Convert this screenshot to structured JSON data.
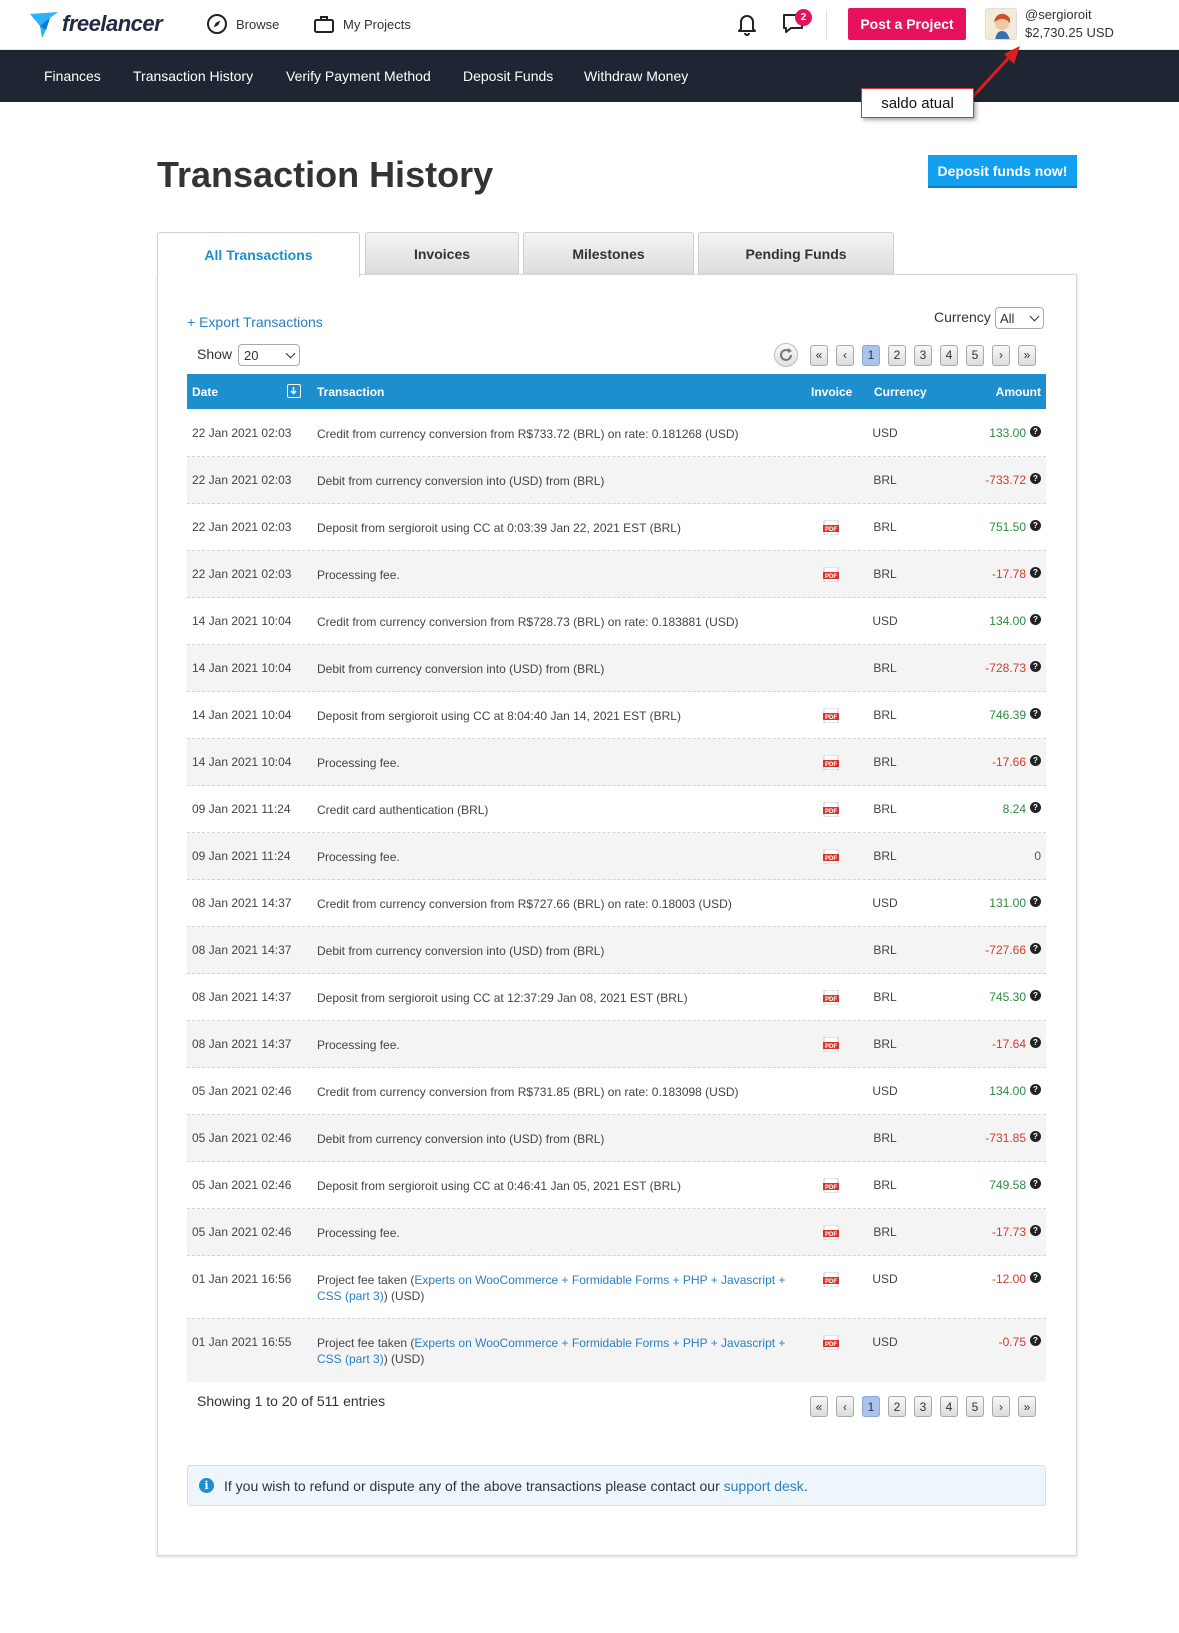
{
  "topbar": {
    "logo_text": "freelancer",
    "browse_label": "Browse",
    "my_projects_label": "My Projects",
    "notification_count": "2",
    "post_project_label": "Post a Project",
    "username": "@sergioroit",
    "balance": "$2,730.25 USD"
  },
  "subnav": [
    "Finances",
    "Transaction History",
    "Verify Payment Method",
    "Deposit Funds",
    "Withdraw Money"
  ],
  "annotation": {
    "text": "saldo atual",
    "color": "#dd1f1f"
  },
  "page": {
    "title": "Transaction History",
    "deposit_button": "Deposit funds now!"
  },
  "tabs": [
    "All Transactions",
    "Invoices",
    "Milestones",
    "Pending Funds"
  ],
  "controls": {
    "export_label": "+ Export Transactions",
    "currency_label": "Currency",
    "currency_value": "All",
    "show_label": "Show",
    "show_value": "20",
    "pages": [
      "«",
      "‹",
      "1",
      "2",
      "3",
      "4",
      "5",
      "›",
      "»"
    ],
    "active_page": "1"
  },
  "table": {
    "headers": {
      "date": "Date",
      "transaction": "Transaction",
      "invoice": "Invoice",
      "currency": "Currency",
      "amount": "Amount"
    },
    "rows": [
      {
        "date": "22 Jan 2021 02:03",
        "desc": "Credit from currency conversion from R$733.72 (BRL) on rate: 0.181268 (USD)",
        "pdf": false,
        "currency": "USD",
        "amount": "133.00",
        "sign": "pos",
        "help": true
      },
      {
        "date": "22 Jan 2021 02:03",
        "desc": "Debit from currency conversion into (USD) from (BRL)",
        "pdf": false,
        "currency": "BRL",
        "amount": "-733.72",
        "sign": "neg",
        "help": true
      },
      {
        "date": "22 Jan 2021 02:03",
        "desc": "Deposit from sergioroit using CC at 0:03:39 Jan 22, 2021 EST (BRL)",
        "pdf": true,
        "currency": "BRL",
        "amount": "751.50",
        "sign": "pos",
        "help": true
      },
      {
        "date": "22 Jan 2021 02:03",
        "desc": "Processing fee.",
        "pdf": true,
        "currency": "BRL",
        "amount": "-17.78",
        "sign": "neg",
        "help": true
      },
      {
        "date": "14 Jan 2021 10:04",
        "desc": "Credit from currency conversion from R$728.73 (BRL) on rate: 0.183881 (USD)",
        "pdf": false,
        "currency": "USD",
        "amount": "134.00",
        "sign": "pos",
        "help": true
      },
      {
        "date": "14 Jan 2021 10:04",
        "desc": "Debit from currency conversion into (USD) from (BRL)",
        "pdf": false,
        "currency": "BRL",
        "amount": "-728.73",
        "sign": "neg",
        "help": true
      },
      {
        "date": "14 Jan 2021 10:04",
        "desc": "Deposit from sergioroit using CC at 8:04:40 Jan 14, 2021 EST (BRL)",
        "pdf": true,
        "currency": "BRL",
        "amount": "746.39",
        "sign": "pos",
        "help": true
      },
      {
        "date": "14 Jan 2021 10:04",
        "desc": "Processing fee.",
        "pdf": true,
        "currency": "BRL",
        "amount": "-17.66",
        "sign": "neg",
        "help": true
      },
      {
        "date": "09 Jan 2021 11:24",
        "desc": "Credit card authentication (BRL)",
        "pdf": true,
        "currency": "BRL",
        "amount": "8.24",
        "sign": "pos",
        "help": true
      },
      {
        "date": "09 Jan 2021 11:24",
        "desc": "Processing fee.",
        "pdf": true,
        "currency": "BRL",
        "amount": "0",
        "sign": "zero",
        "help": false
      },
      {
        "date": "08 Jan 2021 14:37",
        "desc": "Credit from currency conversion from R$727.66 (BRL) on rate: 0.18003 (USD)",
        "pdf": false,
        "currency": "USD",
        "amount": "131.00",
        "sign": "pos",
        "help": true
      },
      {
        "date": "08 Jan 2021 14:37",
        "desc": "Debit from currency conversion into (USD) from (BRL)",
        "pdf": false,
        "currency": "BRL",
        "amount": "-727.66",
        "sign": "neg",
        "help": true
      },
      {
        "date": "08 Jan 2021 14:37",
        "desc": "Deposit from sergioroit using CC at 12:37:29 Jan 08, 2021 EST (BRL)",
        "pdf": true,
        "currency": "BRL",
        "amount": "745.30",
        "sign": "pos",
        "help": true
      },
      {
        "date": "08 Jan 2021 14:37",
        "desc": "Processing fee.",
        "pdf": true,
        "currency": "BRL",
        "amount": "-17.64",
        "sign": "neg",
        "help": true
      },
      {
        "date": "05 Jan 2021 02:46",
        "desc": "Credit from currency conversion from R$731.85 (BRL) on rate: 0.183098 (USD)",
        "pdf": false,
        "currency": "USD",
        "amount": "134.00",
        "sign": "pos",
        "help": true
      },
      {
        "date": "05 Jan 2021 02:46",
        "desc": "Debit from currency conversion into (USD) from (BRL)",
        "pdf": false,
        "currency": "BRL",
        "amount": "-731.85",
        "sign": "neg",
        "help": true
      },
      {
        "date": "05 Jan 2021 02:46",
        "desc": "Deposit from sergioroit using CC at 0:46:41 Jan 05, 2021 EST (BRL)",
        "pdf": true,
        "currency": "BRL",
        "amount": "749.58",
        "sign": "pos",
        "help": true
      },
      {
        "date": "05 Jan 2021 02:46",
        "desc": "Processing fee.",
        "pdf": true,
        "currency": "BRL",
        "amount": "-17.73",
        "sign": "neg",
        "help": true
      },
      {
        "date": "01 Jan 2021 16:56",
        "desc_prefix": "Project fee taken (",
        "desc_link": "Experts on WooCommerce + Formidable Forms + PHP + Javascript + CSS (part 3)",
        "desc_suffix": ") (USD)",
        "pdf": true,
        "currency": "USD",
        "amount": "-12.00",
        "sign": "neg",
        "help": true
      },
      {
        "date": "01 Jan 2021 16:55",
        "desc_prefix": "Project fee taken (",
        "desc_link": "Experts on WooCommerce + Formidable Forms + PHP + Javascript + CSS (part 3)",
        "desc_suffix": ") (USD)",
        "pdf": true,
        "currency": "USD",
        "amount": "-0.75",
        "sign": "neg",
        "help": true
      }
    ]
  },
  "footer": {
    "showing": "Showing 1 to 20 of 511 entries",
    "info_text": "If you wish to refund or dispute any of the above transactions please contact our ",
    "info_link": "support desk",
    "info_end": "."
  },
  "colors": {
    "brand_pink": "#e8115d",
    "blue": "#1d8ece",
    "nav_dark": "#1f2633",
    "positive": "#2c8a3c",
    "negative": "#d23b2b"
  },
  "icons": [
    "compass-icon",
    "briefcase-icon",
    "bell-icon",
    "chat-icon",
    "refresh-icon",
    "pdf-icon",
    "help-icon",
    "info-icon"
  ]
}
